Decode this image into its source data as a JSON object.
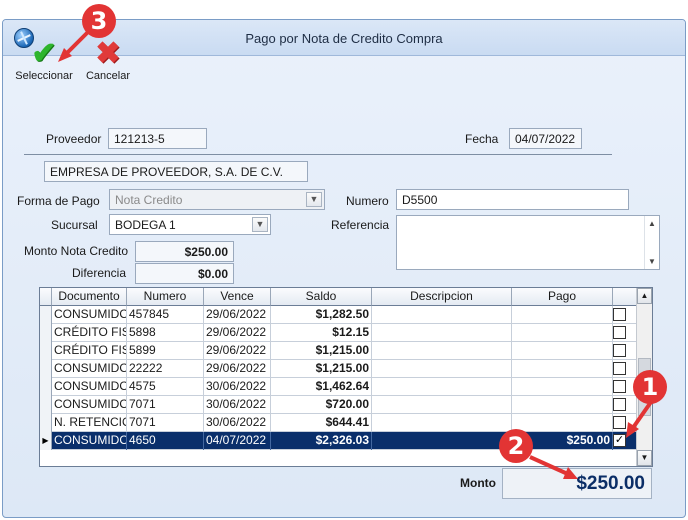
{
  "window": {
    "title": "Pago por Nota de Credito Compra"
  },
  "toolbar": {
    "select_label": "Seleccionar",
    "select_glyph": "✔",
    "cancel_label": "Cancelar",
    "cancel_glyph": "✖"
  },
  "form": {
    "proveedor_label": "Proveedor",
    "proveedor_value": "121213-5",
    "fecha_label": "Fecha",
    "fecha_value": "04/07/2022",
    "empresa_value": "EMPRESA DE PROVEEDOR, S.A. DE C.V.",
    "forma_pago_label": "Forma de Pago",
    "forma_pago_value": "Nota Credito",
    "numero_label": "Numero",
    "numero_value": "D5500",
    "sucursal_label": "Sucursal",
    "sucursal_value": "BODEGA 1",
    "referencia_label": "Referencia",
    "referencia_value": "",
    "monto_nc_label": "Monto Nota Credito",
    "monto_nc_value": "$250.00",
    "diferencia_label": "Diferencia",
    "diferencia_value": "$0.00"
  },
  "grid": {
    "columns": [
      "Documento",
      "Numero",
      "Vence",
      "Saldo",
      "Descripcion",
      "Pago"
    ],
    "rows": [
      {
        "documento": "CONSUMIDO",
        "numero": "457845",
        "vence": "29/06/2022",
        "saldo": "$1,282.50",
        "descripcion": "",
        "pago": "",
        "checked": ""
      },
      {
        "documento": "CRÉDITO FIS",
        "numero": "5898",
        "vence": "29/06/2022",
        "saldo": "$12.15",
        "descripcion": "",
        "pago": "",
        "checked": ""
      },
      {
        "documento": "CRÉDITO FIS",
        "numero": "5899",
        "vence": "29/06/2022",
        "saldo": "$1,215.00",
        "descripcion": "",
        "pago": "",
        "checked": ""
      },
      {
        "documento": "CONSUMIDO",
        "numero": "22222",
        "vence": "29/06/2022",
        "saldo": "$1,215.00",
        "descripcion": "",
        "pago": "",
        "checked": ""
      },
      {
        "documento": "CONSUMIDO",
        "numero": "4575",
        "vence": "30/06/2022",
        "saldo": "$1,462.64",
        "descripcion": "",
        "pago": "",
        "checked": ""
      },
      {
        "documento": "CONSUMIDO",
        "numero": "7071",
        "vence": "30/06/2022",
        "saldo": "$720.00",
        "descripcion": "",
        "pago": "",
        "checked": ""
      },
      {
        "documento": "N. RETENCIO",
        "numero": "7071",
        "vence": "30/06/2022",
        "saldo": "$644.41",
        "descripcion": "",
        "pago": "",
        "checked": ""
      },
      {
        "documento": "CONSUMIDO",
        "numero": "4650",
        "vence": "04/07/2022",
        "saldo": "$2,326.03",
        "descripcion": "",
        "pago": "$250.00",
        "checked": "✓"
      }
    ]
  },
  "footer": {
    "monto_label": "Monto",
    "monto_value": "$250.00"
  },
  "annotations": [
    "3",
    "1",
    "2"
  ],
  "colors": {
    "annotation": "#e23434",
    "selected_row": "#0a2f6b",
    "accept": "#2db52d",
    "cancel": "#e03a3a"
  }
}
